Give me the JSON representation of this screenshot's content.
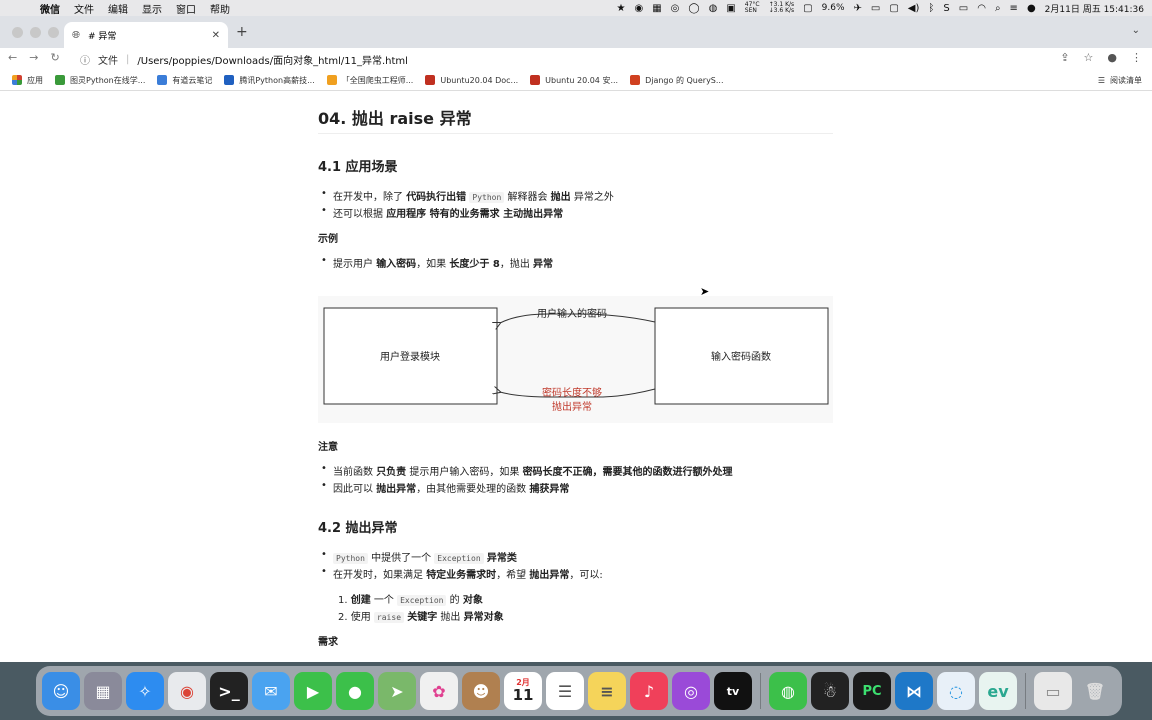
{
  "menubar": {
    "app": "微信",
    "items": [
      "文件",
      "编辑",
      "显示",
      "窗口",
      "帮助"
    ],
    "weather_temp": "47°C",
    "weather_sub": "SEN",
    "net_up": "3.1 K/s",
    "net_down": "3.6 K/s",
    "battery_pct": "9.6",
    "datetime": "2月11日 周五 15:41:36"
  },
  "browser": {
    "tab_title": "# 异常",
    "url_scheme": "文件",
    "url": "/Users/poppies/Downloads/面向对象_html/11_异常.html",
    "bookmarks": [
      {
        "label": "应用",
        "color": "#d04030"
      },
      {
        "label": "图灵Python在线学...",
        "color": "#3a9a3a"
      },
      {
        "label": "有道云笔记",
        "color": "#3b7dd8"
      },
      {
        "label": "腾讯Python高薪技...",
        "color": "#2060c0"
      },
      {
        "label": "「全国爬虫工程师...",
        "color": "#f0a020"
      },
      {
        "label": "Ubuntu20.04 Doc...",
        "color": "#c03020"
      },
      {
        "label": "Ubuntu 20.04 安...",
        "color": "#c03020"
      },
      {
        "label": "Django 的 QueryS...",
        "color": "#d04020"
      }
    ],
    "reading_list": "阅读清单"
  },
  "doc": {
    "h2": "04. 抛出 raise 异常",
    "s41": "4.1 应用场景",
    "s41_li1_a": "在开发中，除了",
    "s41_li1_b": "代码执行出错",
    "s41_li1_code": "Python",
    "s41_li1_c": "解释器会",
    "s41_li1_d": "抛出",
    "s41_li1_e": "异常之外",
    "s41_li2_a": "还可以根据",
    "s41_li2_b": "应用程序 特有的业务需求 主动抛出异常",
    "example": "示例",
    "ex_a": "提示用户",
    "ex_b": "输入密码",
    "ex_c": "，如果",
    "ex_d": "长度少于 8",
    "ex_e": "，抛出",
    "ex_f": "异常",
    "diagram": {
      "left_box": "用户登录模块",
      "right_box": "输入密码函数",
      "top_arrow": "用户输入的密码",
      "bottom_arrow_1": "密码长度不够",
      "bottom_arrow_2": "抛出异常"
    },
    "note": "注意",
    "n1_a": "当前函数",
    "n1_b": "只负责",
    "n1_c": "提示用户输入密码，如果",
    "n1_d": "密码长度不正确，需要其他的函数进行额外处理",
    "n2_a": "因此可以",
    "n2_b": "抛出异常",
    "n2_c": "，由其他需要处理的函数",
    "n2_d": "捕获异常",
    "s42": "4.2 抛出异常",
    "s42_li1_code": "Python",
    "s42_li1_a": "中提供了一个",
    "s42_li1_code2": "Exception",
    "s42_li1_b": "异常类",
    "s42_li2_a": "在开发时，如果满足",
    "s42_li2_b": "特定业务需求时",
    "s42_li2_c": "，希望",
    "s42_li2_d": "抛出异常",
    "s42_li2_e": "，可以:",
    "o1_num": "1.",
    "o1_a": "创建",
    "o1_b": "一个",
    "o1_code": "Exception",
    "o1_c": "的",
    "o1_d": "对象",
    "o2_num": "2.",
    "o2_a": "使用",
    "o2_code": "raise",
    "o2_b": "关键字",
    "o2_c": "抛出",
    "o2_d": "异常对象",
    "need": "需求"
  },
  "dock": {
    "calendar_month": "2月",
    "calendar_day": "11",
    "apps": [
      "finder",
      "launchpad",
      "safari",
      "chrome",
      "terminal",
      "mail",
      "facetime",
      "messages",
      "maps",
      "photos",
      "contacts",
      "calendar",
      "reminders",
      "notes",
      "music",
      "podcasts",
      "tv",
      "wechat",
      "qq",
      "pycharm",
      "vscode",
      "qq-chat",
      "edge",
      "screenshot",
      "trash"
    ]
  }
}
